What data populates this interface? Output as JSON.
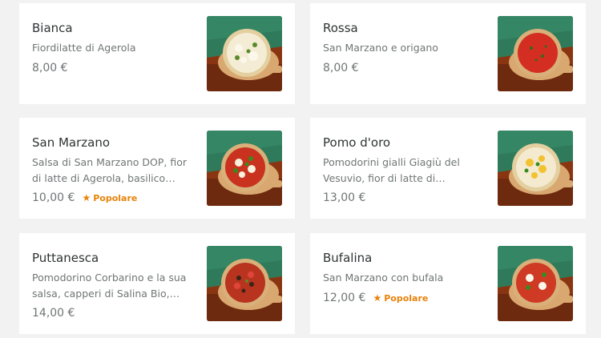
{
  "menu": {
    "items": [
      {
        "name": "Bianca",
        "description": "Fiordilatte di Agerola",
        "price": "8,00 €",
        "badge": "",
        "icon": "pizza-bianca-photo"
      },
      {
        "name": "Rossa",
        "description": "San Marzano e origano",
        "price": "8,00 €",
        "badge": "",
        "icon": "pizza-rossa-photo"
      },
      {
        "name": "San Marzano",
        "description": "Salsa di San Marzano DOP, fior di latte di Agerola, basilico fresco ...",
        "price": "10,00 €",
        "badge": "Popolare",
        "icon": "pizza-san-marzano-photo"
      },
      {
        "name": "Pomo d'oro",
        "description": "Pomodorini gialli Giagiù del Vesuvio, fior di latte di Agerola,...",
        "price": "13,00 €",
        "badge": "",
        "icon": "pizza-pomo-doro-photo"
      },
      {
        "name": "Puttanesca",
        "description": "Pomodorino Corbarino e la sua salsa, capperi di Salina Bio, oliv...",
        "price": "14,00 €",
        "badge": "",
        "icon": "pizza-puttanesca-photo"
      },
      {
        "name": "Bufalina",
        "description": "San Marzano con bufala",
        "price": "12,00 €",
        "badge": "Popolare",
        "icon": "pizza-bufalina-photo"
      }
    ]
  },
  "colors": {
    "badge": "#e8830a",
    "text_primary": "#2e3333",
    "text_secondary": "#707575",
    "background": "#f2f2f2"
  }
}
